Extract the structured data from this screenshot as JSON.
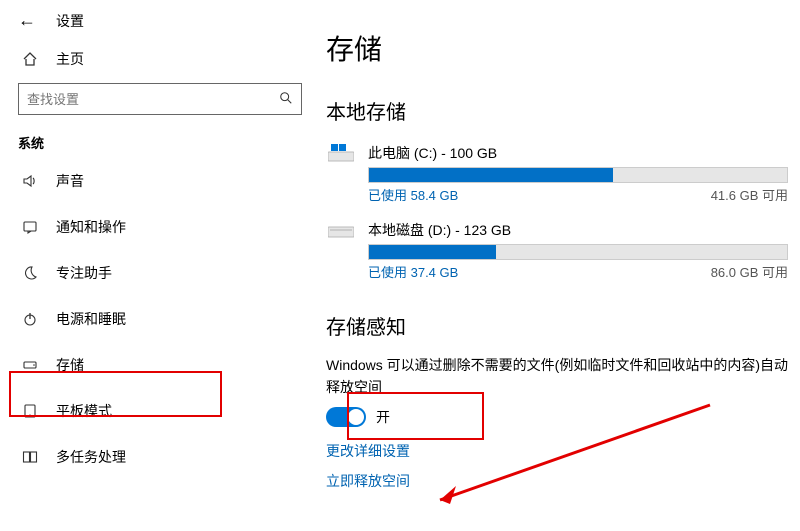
{
  "topbar": {
    "title": "设置"
  },
  "home": {
    "label": "主页"
  },
  "search": {
    "placeholder": "查找设置"
  },
  "section": {
    "label": "系统"
  },
  "nav": {
    "sound": "声音",
    "notifications": "通知和操作",
    "focus": "专注助手",
    "power": "电源和睡眠",
    "storage": "存储",
    "tablet": "平板模式",
    "multitask": "多任务处理"
  },
  "page": {
    "title": "存储"
  },
  "local": {
    "heading": "本地存储"
  },
  "drives": [
    {
      "name": "此电脑 (C:) - 100 GB",
      "used_label": "已使用 58.4 GB",
      "free_label": "41.6 GB 可用",
      "used_pct": 58.4
    },
    {
      "name": "本地磁盘 (D:) - 123 GB",
      "used_label": "已使用 37.4 GB",
      "free_label": "86.0 GB 可用",
      "used_pct": 30.4
    }
  ],
  "sense": {
    "heading": "存储感知",
    "desc": "Windows 可以通过删除不需要的文件(例如临时文件和回收站中的内容)自动释放空间",
    "toggle_label": "开",
    "link_details": "更改详细设置",
    "link_freeup": "立即释放空间"
  }
}
